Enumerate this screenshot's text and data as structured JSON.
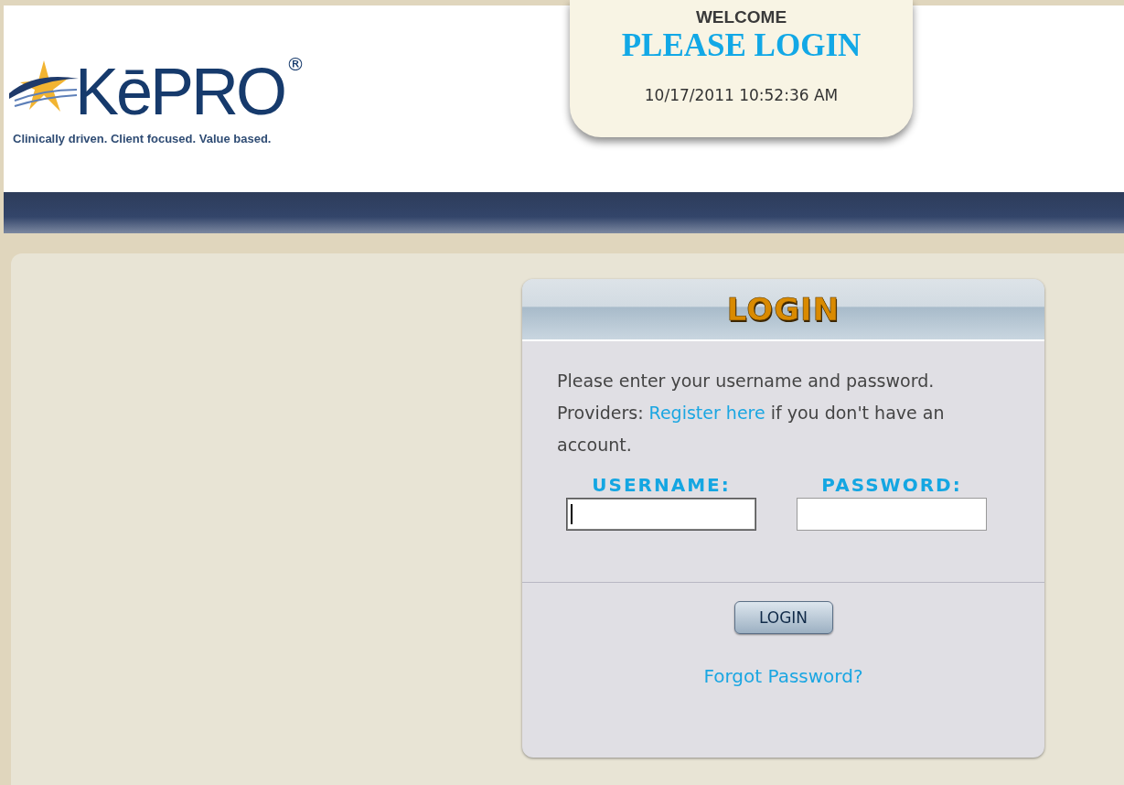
{
  "logo": {
    "wordmark": "KēPRO",
    "registered": "®",
    "tagline": "Clinically driven. Client focused. Value based."
  },
  "welcome": {
    "greeting": "WELCOME",
    "title": "PLEASE LOGIN",
    "datetime": "10/17/2011 10:52:36 AM"
  },
  "login": {
    "title": "LOGIN",
    "intro_before": "Please enter your username and password. Providers:",
    "register_link": "Register here",
    "intro_after": "if you don't have an account.",
    "fields": [
      {
        "label": "USERNAME:",
        "focused": true
      },
      {
        "label": "PASSWORD:",
        "focused": false
      }
    ],
    "button": "LOGIN",
    "forgot_link": "Forgot Password?"
  }
}
